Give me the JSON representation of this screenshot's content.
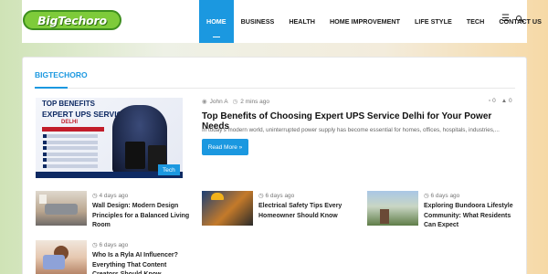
{
  "header": {
    "logo_text": "BigTechoro",
    "nav": [
      "HOME",
      "BUSINESS",
      "HEALTH",
      "HOME IMPROVEMENT",
      "LIFE STYLE",
      "TECH",
      "CONTACT US"
    ],
    "icons": [
      "menu-icon",
      "search-icon"
    ]
  },
  "section": {
    "title": "BIGTECHORO"
  },
  "featured": {
    "image_text": {
      "line1": "TOP BENEFITS",
      "line2": "EXPERT UPS SERVICE",
      "line3": "DELHI"
    },
    "tag": "Tech",
    "author": "John A",
    "time": "2 mins ago",
    "comments": "0",
    "views": "0",
    "title": "Top Benefits of Choosing Expert UPS Service Delhi for Your Power Needs",
    "excerpt": "In today's modern world, uninterrupted power supply has become essential for homes, offices, hospitals, industries,...",
    "read_more": "Read More »"
  },
  "posts": [
    {
      "date": "4 days ago",
      "title": "Wall Design: Modern Design Principles for a Balanced Living Room"
    },
    {
      "date": "6 days ago",
      "title": "Electrical Safety Tips Every Homeowner Should Know"
    },
    {
      "date": "6 days ago",
      "title": "Exploring Bundoora Lifestyle Community: What Residents Can Expect"
    },
    {
      "date": "6 days ago",
      "title": "Who Is a Ryla AI Influencer? Everything That Content Creators Should Know"
    }
  ],
  "colors": {
    "accent": "#1b98e0",
    "logo_green": "#7ecb3a"
  }
}
